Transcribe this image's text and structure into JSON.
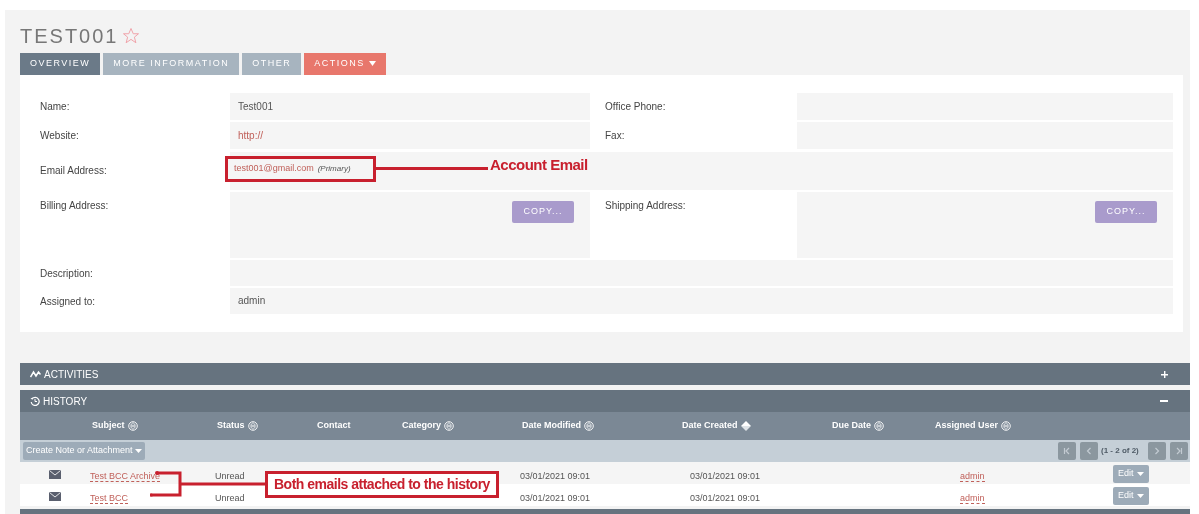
{
  "record": {
    "title": "TEST001",
    "favorite": false
  },
  "tabs": [
    {
      "label": "OVERVIEW",
      "selected": true,
      "kind": "tab"
    },
    {
      "label": "MORE INFORMATION",
      "selected": false,
      "kind": "tab"
    },
    {
      "label": "OTHER",
      "selected": false,
      "kind": "tab"
    },
    {
      "label": "ACTIONS",
      "selected": false,
      "kind": "menu"
    }
  ],
  "rows": [
    {
      "kind": "pair",
      "left": {
        "label": "Name:",
        "value": "Test001",
        "link": false
      },
      "right": {
        "label": "Office Phone:"
      }
    },
    {
      "kind": "pair",
      "left": {
        "label": "Website:",
        "value": "http://",
        "link": true
      },
      "right": {
        "label": "Fax:"
      }
    },
    {
      "kind": "email",
      "label": "Email Address:",
      "email": "test001@gmail.com",
      "note": "(Primary)",
      "annotation": "Account Email"
    },
    {
      "kind": "address",
      "left": {
        "label": "Billing Address:",
        "button": "COPY..."
      },
      "right": {
        "label": "Shipping Address:",
        "button": "COPY..."
      }
    },
    {
      "kind": "full",
      "label": "Description:"
    },
    {
      "kind": "full",
      "label": "Assigned to:",
      "value": "admin"
    }
  ],
  "subpanels": [
    {
      "title": "ACTIVITIES",
      "kind": "activities",
      "expanded": false
    },
    {
      "title": "HISTORY",
      "kind": "history",
      "expanded": true
    }
  ],
  "history": {
    "columns": [
      {
        "label": "Subject",
        "sortable": true,
        "sorted": false
      },
      {
        "label": "Status",
        "sortable": true,
        "sorted": false
      },
      {
        "label": "Contact",
        "sortable": false
      },
      {
        "label": "Category",
        "sortable": true,
        "sorted": false
      },
      {
        "label": "Date Modified",
        "sortable": true,
        "sorted": false
      },
      {
        "label": "Date Created",
        "sortable": true,
        "sorted": true
      },
      {
        "label": "Due Date",
        "sortable": true,
        "sorted": false
      },
      {
        "label": "Assigned User",
        "sortable": true,
        "sorted": false
      }
    ],
    "create_button": "Create Note or Attachment",
    "pagination": "(1 - 2 of 2)",
    "rows": [
      {
        "subject": "Test BCC Archive",
        "status": "Unread",
        "date_modified": "03/01/2021 09:01",
        "date_created": "03/01/2021 09:01",
        "assigned_user": "admin",
        "action": "Edit"
      },
      {
        "subject": "Test BCC",
        "status": "Unread",
        "date_modified": "03/01/2021 09:01",
        "date_created": "03/01/2021 09:01",
        "assigned_user": "admin",
        "action": "Edit"
      }
    ],
    "annotation": "Both emails attached to the history"
  }
}
